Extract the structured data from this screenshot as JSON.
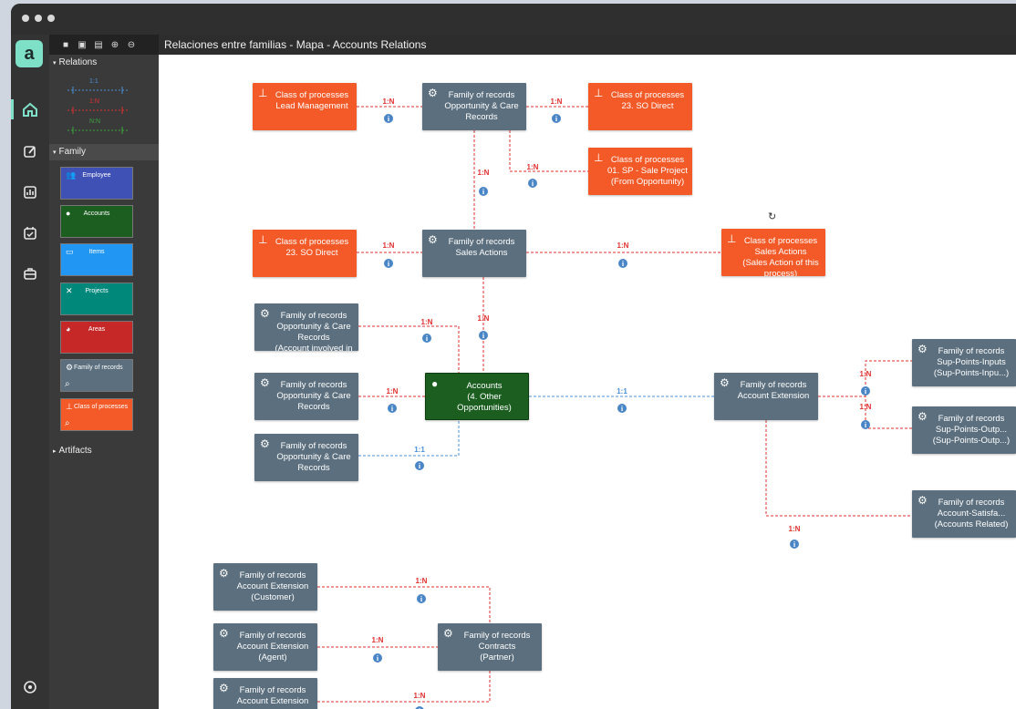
{
  "window": {
    "title": "Relaciones entre familias - Mapa - Accounts Relations"
  },
  "colors": {
    "process": "#f45a28",
    "family": "#5b6f7e",
    "accounts": "#1b5e20",
    "accent": "#7fe0c8",
    "rel_1_1": "#4a90d9",
    "rel_1_n": "#e03030",
    "rel_n_n": "#3aa63a"
  },
  "rail": {
    "logo": "a",
    "icons": [
      "home-icon",
      "edit-icon",
      "chart-icon",
      "calendar-check-icon",
      "briefcase-icon"
    ],
    "settings_icon": "settings-icon"
  },
  "toolbar": {
    "icons": [
      "new-icon",
      "save-icon",
      "save-as-icon",
      "zoom-in-icon",
      "zoom-out-icon"
    ]
  },
  "panel": {
    "relations_label": "Relations",
    "relations": [
      {
        "label": "1:1",
        "color": "#4a90d9"
      },
      {
        "label": "1:N",
        "color": "#e03030"
      },
      {
        "label": "N:N",
        "color": "#3aa63a"
      }
    ],
    "family_label": "Family",
    "families": [
      {
        "label": "Employee",
        "color": "#3f51b5",
        "icon": "people-icon"
      },
      {
        "label": "Accounts",
        "color": "#1b5e20",
        "icon": "person-icon"
      },
      {
        "label": "Items",
        "color": "#2196f3",
        "icon": "monitor-icon"
      },
      {
        "label": "Projects",
        "color": "#00897b",
        "icon": "tools-icon"
      },
      {
        "label": "Areas",
        "color": "#c62828",
        "icon": "pie-icon"
      },
      {
        "label": "Family of records",
        "color": "#5b6f7e",
        "icon": "gear-icon"
      },
      {
        "label": "Class of processes",
        "color": "#f45a28",
        "icon": "hierarchy-icon"
      }
    ],
    "artifacts_label": "Artifacts"
  },
  "nodes": [
    {
      "id": "lead",
      "kind": "proc",
      "lines": [
        "Class of processes",
        "Lead Management"
      ]
    },
    {
      "id": "occ_top",
      "kind": "fam",
      "lines": [
        "Family of records",
        "Opportunity & Care",
        "Records"
      ]
    },
    {
      "id": "so_top",
      "kind": "proc",
      "lines": [
        "Class of processes",
        "23. SO Direct"
      ]
    },
    {
      "id": "sp",
      "kind": "proc",
      "lines": [
        "Class of processes",
        "01. SP - Sale Project",
        "(From Opportunity)"
      ]
    },
    {
      "id": "so_mid",
      "kind": "proc",
      "lines": [
        "Class of processes",
        "23. SO Direct"
      ]
    },
    {
      "id": "sales_actions",
      "kind": "fam",
      "lines": [
        "Family of records",
        "Sales Actions"
      ]
    },
    {
      "id": "sales_proc",
      "kind": "proc",
      "lines": [
        "Class of processes",
        "Sales Actions",
        "(Sales Action of this",
        "process)"
      ]
    },
    {
      "id": "occ_involved",
      "kind": "fam",
      "lines": [
        "Family of records",
        "Opportunity & Care",
        "Records",
        "(Account involved in"
      ]
    },
    {
      "id": "occ_left",
      "kind": "fam",
      "lines": [
        "Family of records",
        "Opportunity & Care",
        "Records"
      ]
    },
    {
      "id": "accounts",
      "kind": "acc",
      "lines": [
        "Accounts",
        "(4. Other",
        "Opportunities)"
      ]
    },
    {
      "id": "acc_ext",
      "kind": "fam",
      "lines": [
        "Family of records",
        "Account Extension"
      ]
    },
    {
      "id": "occ_low",
      "kind": "fam",
      "lines": [
        "Family of records",
        "Opportunity & Care",
        "Records"
      ]
    },
    {
      "id": "sup_in",
      "kind": "fam",
      "lines": [
        "Family of records",
        "Sup-Points-Inputs",
        "(Sup-Points-Inpu...)"
      ]
    },
    {
      "id": "sup_out",
      "kind": "fam",
      "lines": [
        "Family of records",
        "Sup-Points-Outp...",
        "(Sup-Points-Outp...)"
      ]
    },
    {
      "id": "acc_sat",
      "kind": "fam",
      "lines": [
        "Family of records",
        "Account-Satisfa...",
        "(Accounts Related)"
      ]
    },
    {
      "id": "ext_cust",
      "kind": "fam",
      "lines": [
        "Family of records",
        "Account Extension",
        "(Customer)"
      ]
    },
    {
      "id": "ext_agent",
      "kind": "fam",
      "lines": [
        "Family of records",
        "Account Extension",
        "(Agent)"
      ]
    },
    {
      "id": "contracts",
      "kind": "fam",
      "lines": [
        "Family of records",
        "Contracts",
        "(Partner)"
      ]
    },
    {
      "id": "ext_bottom",
      "kind": "fam",
      "lines": [
        "Family of records",
        "Account Extension"
      ]
    }
  ],
  "relation_labels": {
    "one_to_one": "1:1",
    "one_to_n": "1:N",
    "info_glyph": "i"
  }
}
